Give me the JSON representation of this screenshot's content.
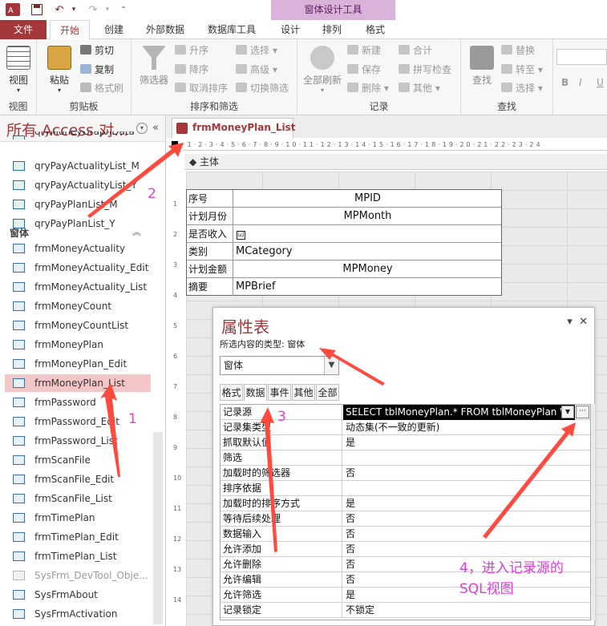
{
  "window": {
    "app_icon": "access-app-icon",
    "quick_access": [
      "save-icon",
      "undo-icon",
      "redo-icon",
      "customize-qat-icon"
    ],
    "contextual_title": "窗体设计工具"
  },
  "tabs": [
    "文件",
    "开始",
    "创建",
    "外部数据",
    "数据库工具",
    "设计",
    "排列",
    "格式"
  ],
  "ribbon": {
    "views": {
      "label": "视图",
      "button": "视图"
    },
    "clipboard": {
      "label": "剪贴板",
      "paste": "粘贴",
      "cut": "剪切",
      "copy": "复制",
      "format_painter": "格式刷"
    },
    "sort_filter": {
      "label": "排序和筛选",
      "filter": "筛选器",
      "asc": "升序",
      "desc": "降序",
      "remove_sort": "取消排序",
      "selection": "选择",
      "advanced": "高级",
      "toggle_filter": "切换筛选"
    },
    "records": {
      "label": "记录",
      "refresh_all": "全部刷新",
      "new": "新建",
      "save": "保存",
      "delete": "删除",
      "totals": "合计",
      "spelling": "拼写检查",
      "more": "其他"
    },
    "find": {
      "label": "查找",
      "find": "查找",
      "replace": "替换",
      "goto": "转至",
      "select": "选择"
    },
    "text_format": [
      "B",
      "I",
      "U"
    ]
  },
  "nav": {
    "title": "所有 Access 对...",
    "queries": [
      {
        "name": "qryMoneyGraphData",
        "type": "query"
      },
      {
        "name": "qryPayActualityList_M",
        "type": "query"
      },
      {
        "name": "qryPayActualityList_Y",
        "type": "query"
      },
      {
        "name": "qryPayPlanList_M",
        "type": "query"
      },
      {
        "name": "qryPayPlanList_Y",
        "type": "query"
      }
    ],
    "forms_section": "窗体",
    "forms": [
      {
        "name": "frmMoneyActuality",
        "selected": false,
        "grey": false
      },
      {
        "name": "frmMoneyActuality_Edit",
        "selected": false,
        "grey": false
      },
      {
        "name": "frmMoneyActuality_List",
        "selected": false,
        "grey": false
      },
      {
        "name": "frmMoneyCount",
        "selected": false,
        "grey": false
      },
      {
        "name": "frmMoneyCountList",
        "selected": false,
        "grey": false
      },
      {
        "name": "frmMoneyPlan",
        "selected": false,
        "grey": false
      },
      {
        "name": "frmMoneyPlan_Edit",
        "selected": false,
        "grey": false
      },
      {
        "name": "frmMoneyPlan_List",
        "selected": true,
        "grey": false
      },
      {
        "name": "frmPassword",
        "selected": false,
        "grey": false
      },
      {
        "name": "frmPassword_Edit",
        "selected": false,
        "grey": false
      },
      {
        "name": "frmPassword_List",
        "selected": false,
        "grey": false
      },
      {
        "name": "frmScanFile",
        "selected": false,
        "grey": false
      },
      {
        "name": "frmScanFile_Edit",
        "selected": false,
        "grey": false
      },
      {
        "name": "frmScanFile_List",
        "selected": false,
        "grey": false
      },
      {
        "name": "frmTimePlan",
        "selected": false,
        "grey": false
      },
      {
        "name": "frmTimePlan_Edit",
        "selected": false,
        "grey": false
      },
      {
        "name": "frmTimePlan_List",
        "selected": false,
        "grey": false
      },
      {
        "name": "SysFrm_DevTool_Obje...",
        "selected": false,
        "grey": true
      },
      {
        "name": "SysFrmAbout",
        "selected": false,
        "grey": false
      },
      {
        "name": "SysFrmActivation",
        "selected": false,
        "grey": false
      }
    ]
  },
  "document": {
    "tab_title": "frmMoneyPlan_List",
    "detail_section": "主体",
    "ruler_numbers": [
      "1",
      "2",
      "3",
      "4",
      "5",
      "6",
      "7",
      "8",
      "9",
      "10",
      "11",
      "12",
      "13",
      "14"
    ],
    "form_rows": [
      {
        "label": "序号",
        "field": "MPID",
        "align": "center"
      },
      {
        "label": "计划月份",
        "field": "MPMonth",
        "align": "center"
      },
      {
        "label": "是否收入",
        "field": "☑",
        "align": "checkbox"
      },
      {
        "label": "类别",
        "field": "MCategory",
        "align": "left"
      },
      {
        "label": "计划金额",
        "field": "MPMoney",
        "align": "center"
      },
      {
        "label": "摘要",
        "field": "MPBrief",
        "align": "left"
      }
    ]
  },
  "property_sheet": {
    "title": "属性表",
    "selection_type_label": "所选内容的类型:",
    "selection_type_value": "窗体",
    "combo_value": "窗体",
    "tabs": [
      "格式",
      "数据",
      "事件",
      "其他",
      "全部"
    ],
    "active_tab": "数据",
    "rows": [
      {
        "name": "记录源",
        "value": "SELECT tblMoneyPlan.* FROM tblMoneyPlan W",
        "highlight": true
      },
      {
        "name": "记录集类型",
        "value": "动态集(不一致的更新)"
      },
      {
        "name": "抓取默认值",
        "value": "是"
      },
      {
        "name": "筛选",
        "value": ""
      },
      {
        "name": "加载时的筛选器",
        "value": "否"
      },
      {
        "name": "排序依据",
        "value": ""
      },
      {
        "name": "加载时的排序方式",
        "value": "是"
      },
      {
        "name": "等待后续处理",
        "value": "否"
      },
      {
        "name": "数据输入",
        "value": "否"
      },
      {
        "name": "允许添加",
        "value": "否"
      },
      {
        "name": "允许删除",
        "value": "否"
      },
      {
        "name": "允许编辑",
        "value": "否"
      },
      {
        "name": "允许筛选",
        "value": "是"
      },
      {
        "name": "记录锁定",
        "value": "不锁定"
      }
    ]
  },
  "annotations": {
    "n1": "1",
    "n2": "2",
    "n3": "3",
    "n4": "4，进入记录源的",
    "n4b": "SQL视图",
    "color": "#e23bd6",
    "arrow_color": "#ff4a3d"
  },
  "colors": {
    "access_accent": "#a4373a",
    "contextual_tab": "#d9b3d9",
    "selected_item": "#f3c6c8"
  }
}
